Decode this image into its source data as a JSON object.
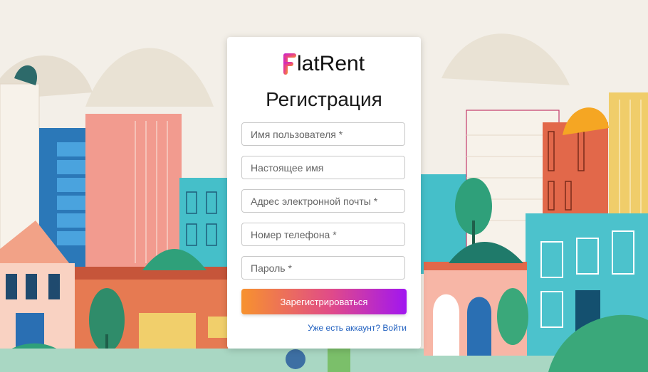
{
  "brand": {
    "name": "latRent",
    "letter": "F",
    "gradient_colors": [
      "#f7922e",
      "#e04a8a",
      "#a116f0"
    ]
  },
  "form": {
    "title": "Регистрация",
    "fields": [
      {
        "name": "username",
        "placeholder": "Имя пользователя *",
        "value": ""
      },
      {
        "name": "real_name",
        "placeholder": "Настоящее имя",
        "value": ""
      },
      {
        "name": "email",
        "placeholder": "Адрес электронной почты *",
        "value": ""
      },
      {
        "name": "phone",
        "placeholder": "Номер телефона *",
        "value": ""
      },
      {
        "name": "password",
        "placeholder": "Пароль *",
        "value": ""
      }
    ],
    "submit_label": "Зарегистрироваться",
    "login_link": "Уже есть аккаунт? Войти"
  },
  "colors": {
    "background": "#f3efe8",
    "link": "#1f5fbf"
  }
}
